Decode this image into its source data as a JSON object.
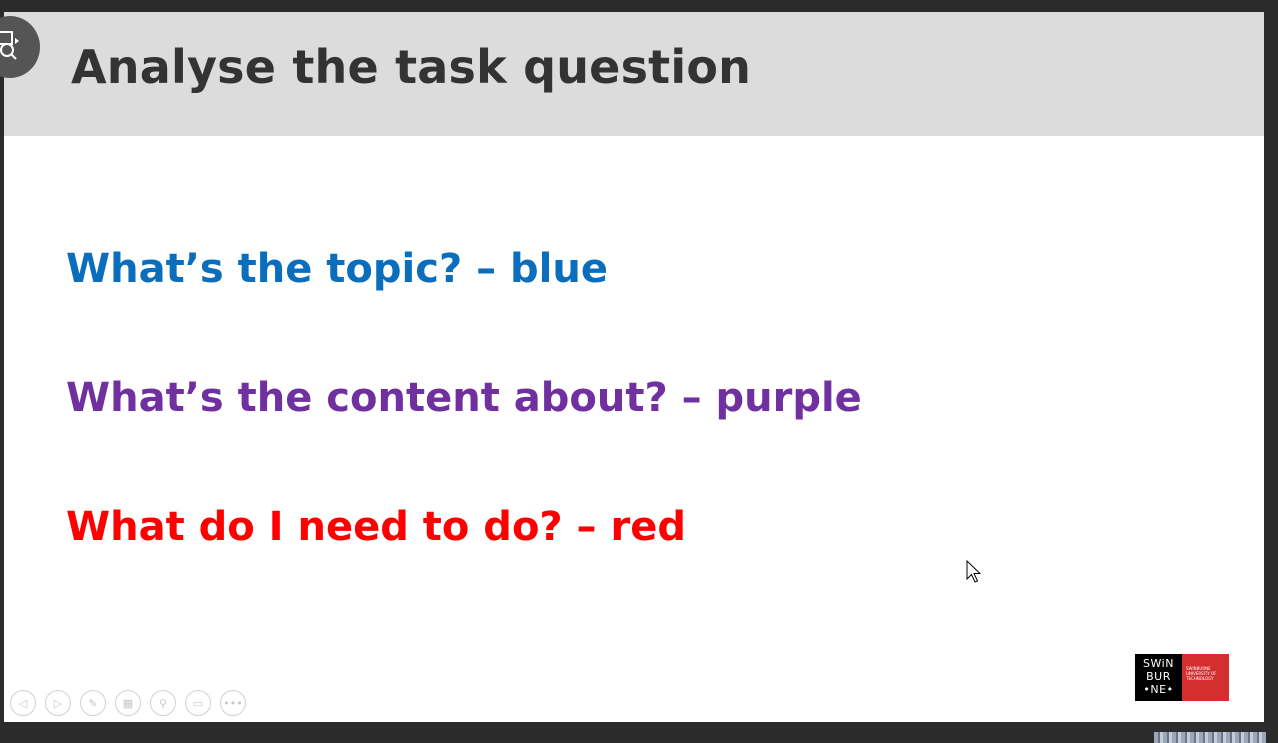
{
  "slide": {
    "title": "Analyse the task question",
    "lines": [
      {
        "text": "What’s the topic? – blue",
        "color": "#0a6ebd"
      },
      {
        "text": "What’s the content about? – purple",
        "color": "#7030a0"
      },
      {
        "text": "What do I need to do? – red",
        "color": "#ff0000"
      }
    ]
  },
  "logo": {
    "wordmark_lines": [
      "SWiN",
      "BUR",
      "•NE•"
    ],
    "subtitle": "SWINBURNE UNIVERSITY OF TECHNOLOGY"
  },
  "controls": [
    {
      "icon": "previous-icon",
      "glyph": "◁"
    },
    {
      "icon": "next-icon",
      "glyph": "▷"
    },
    {
      "icon": "pen-icon",
      "glyph": "✎"
    },
    {
      "icon": "slides-grid-icon",
      "glyph": "▦"
    },
    {
      "icon": "zoom-icon",
      "glyph": "⚲"
    },
    {
      "icon": "subtitles-icon",
      "glyph": "▭"
    },
    {
      "icon": "more-options-icon",
      "glyph": "•••"
    }
  ],
  "viewer": {
    "icon": "screen-zoom-icon"
  }
}
